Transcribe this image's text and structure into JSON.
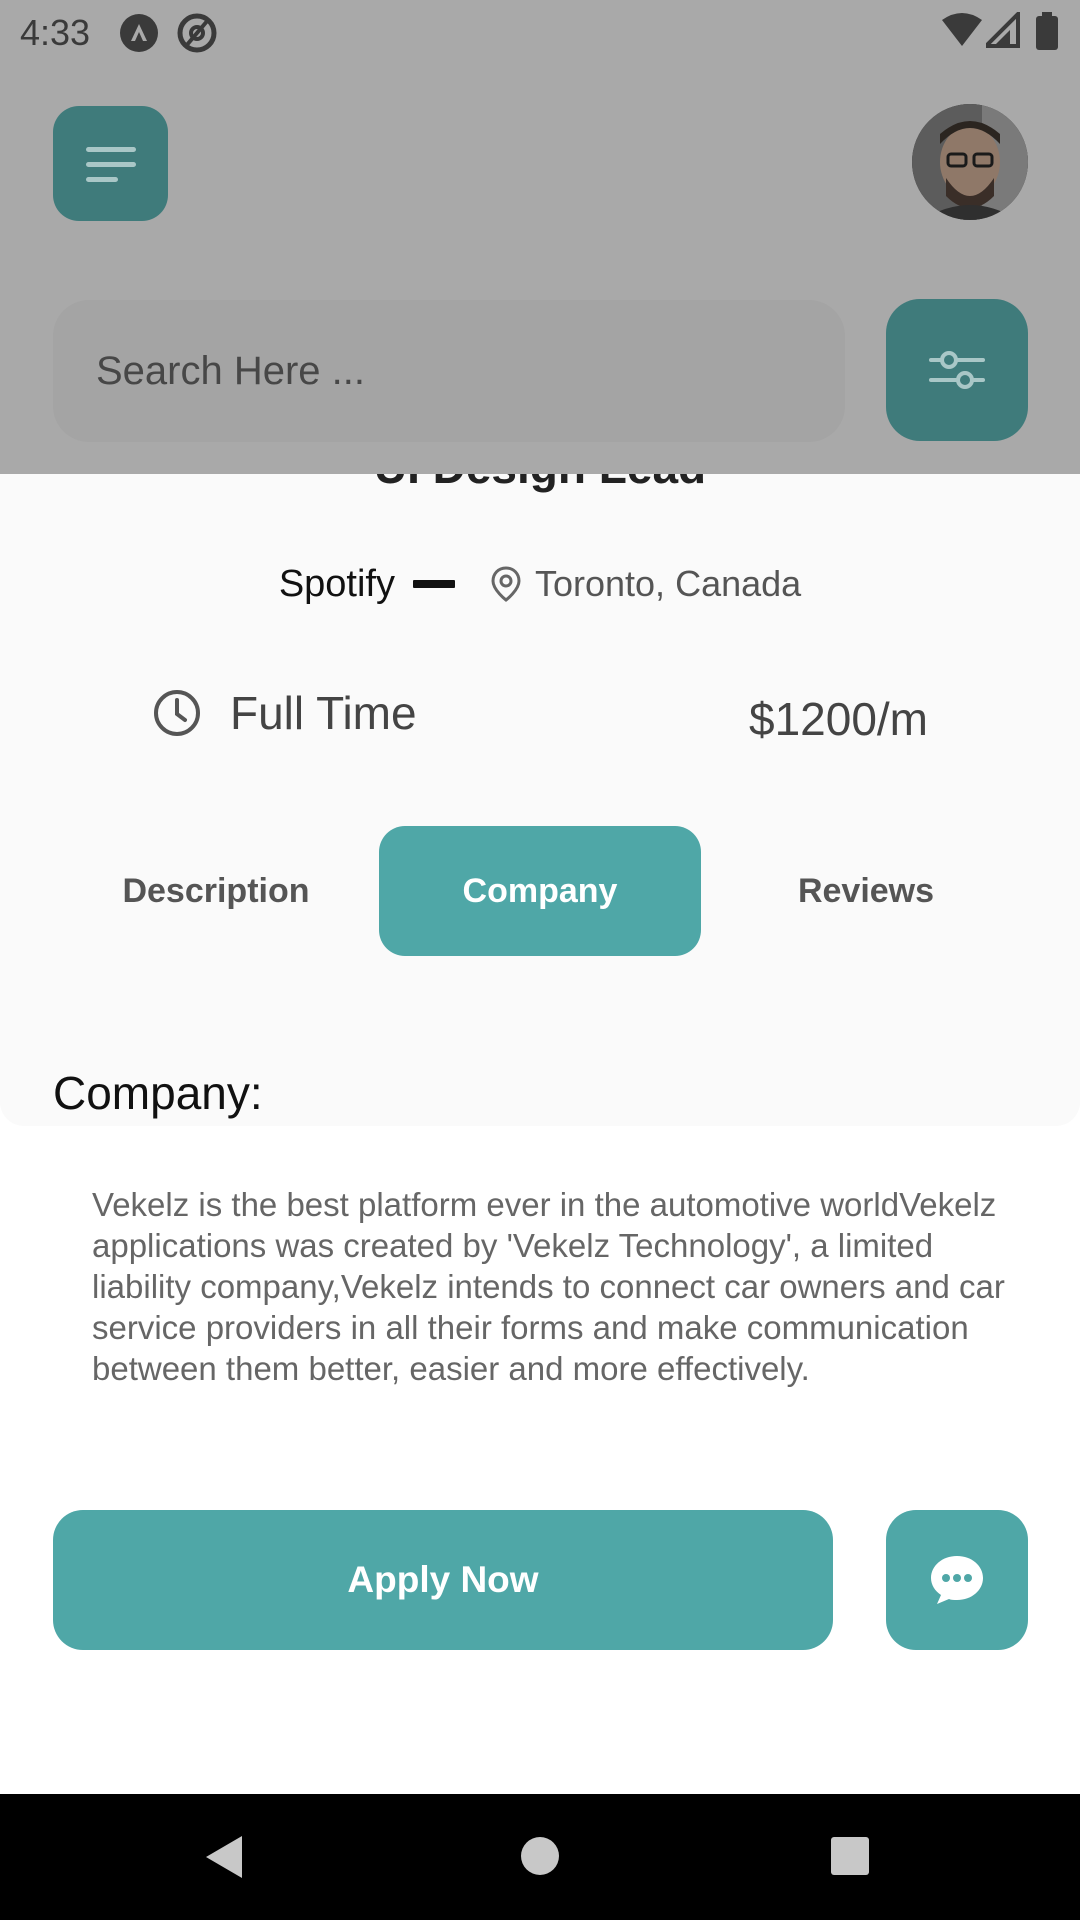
{
  "status_bar": {
    "time": "4:33",
    "icons": [
      "app-notification-icon",
      "at-sign-icon",
      "wifi-icon",
      "signal-icon",
      "battery-icon"
    ]
  },
  "header": {
    "menu_icon": "menu-icon",
    "avatar": "profile-avatar"
  },
  "search": {
    "placeholder": "Search Here ...",
    "filter_icon": "filter-sliders-icon"
  },
  "job": {
    "title": "UI Design Lead",
    "company": "Spotify",
    "location": "Toronto, Canada",
    "type": "Full Time",
    "salary": "$1200/m"
  },
  "tabs": [
    {
      "label": "Description",
      "active": false
    },
    {
      "label": "Company",
      "active": true
    },
    {
      "label": "Reviews",
      "active": false
    }
  ],
  "company_section": {
    "heading": "Company:",
    "text": "Vekelz is the best platform ever in the automotive worldVekelz applications was created by 'Vekelz Technology', a limited liability company,Vekelz intends to connect car owners and car service providers in all their forms and make communication between them better, easier and more effectively."
  },
  "actions": {
    "apply_label": "Apply Now",
    "chat_icon": "chat-bubble-icon"
  },
  "colors": {
    "accent": "#4fa7a7",
    "accent_dimmed": "#3f7b7b",
    "overlay": "#a9a9a9"
  }
}
